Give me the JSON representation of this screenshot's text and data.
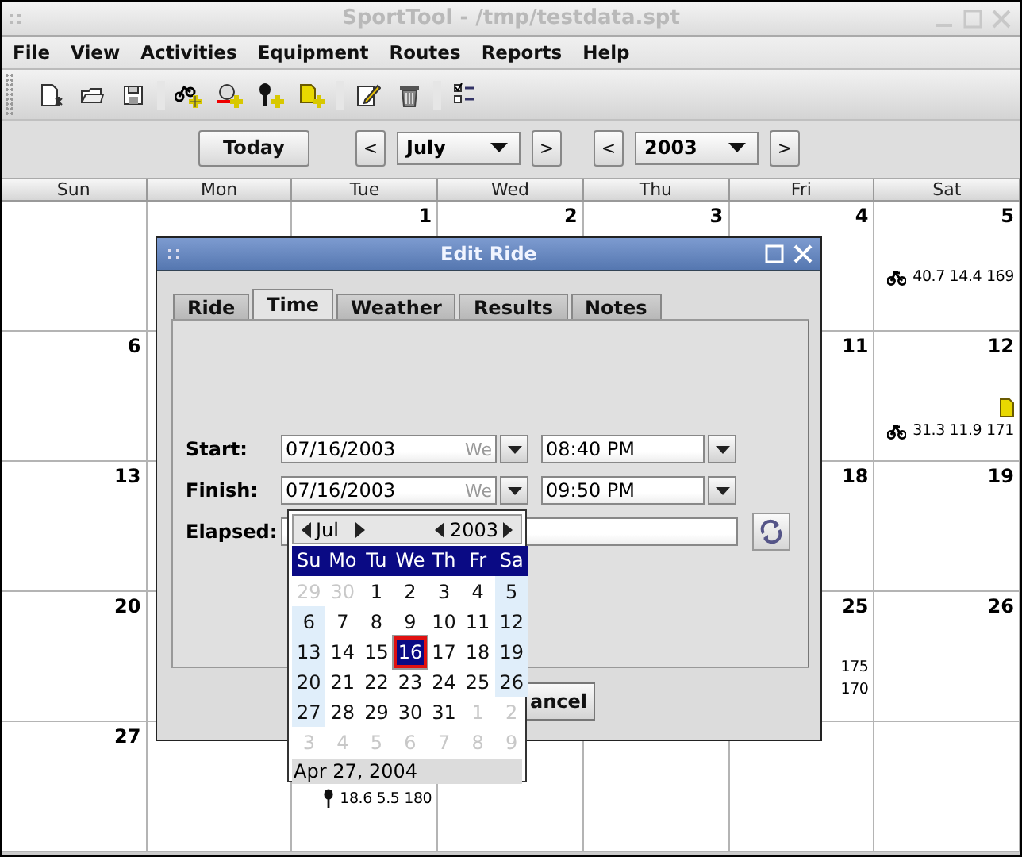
{
  "window": {
    "title": "SportTool - /tmp/testdata.spt"
  },
  "menu": [
    "File",
    "View",
    "Activities",
    "Equipment",
    "Routes",
    "Reports",
    "Help"
  ],
  "navigator": {
    "today": "Today",
    "month_prev": "<",
    "month": "July",
    "month_next": ">",
    "year_prev": "<",
    "year": "2003",
    "year_next": ">"
  },
  "calendar": {
    "weekdays": [
      "Sun",
      "Mon",
      "Tue",
      "Wed",
      "Thu",
      "Fri",
      "Sat"
    ],
    "weeks": [
      {
        "tue": {
          "day": "1"
        },
        "wed": {
          "day": "2"
        },
        "thu": {
          "day": "3"
        },
        "fri": {
          "day": "4"
        },
        "sat": {
          "day": "5",
          "entries": [
            {
              "kind": "ride",
              "text": "40.7 14.4 169"
            }
          ]
        }
      },
      {
        "sun": {
          "day": "6"
        },
        "fri": {
          "day": "11"
        },
        "sat": {
          "day": "12",
          "entries": [
            {
              "kind": "note"
            },
            {
              "kind": "ride",
              "text": "31.3 11.9 171"
            }
          ]
        }
      },
      {
        "sun": {
          "day": "13"
        },
        "fri": {
          "day": "18"
        },
        "sat": {
          "day": "19"
        }
      },
      {
        "sun": {
          "day": "20"
        },
        "fri": {
          "day": "25",
          "entries": [
            {
              "text": "175"
            },
            {
              "text": "170"
            }
          ]
        },
        "sat": {
          "day": "26"
        }
      },
      {
        "sun": {
          "day": "27"
        },
        "tue": {
          "entries": [
            {
              "kind": "pin",
              "text": "18.6 5.5 180"
            }
          ]
        }
      }
    ]
  },
  "dialog": {
    "title": "Edit Ride",
    "tabs": [
      {
        "label": "Ride",
        "selected": false
      },
      {
        "label": "Time",
        "selected": true
      },
      {
        "label": "Weather",
        "selected": false
      },
      {
        "label": "Results",
        "selected": false
      },
      {
        "label": "Notes",
        "selected": false
      }
    ],
    "start": {
      "label": "Start:",
      "date": "07/16/2003",
      "weekday": "We",
      "time": "08:40 PM"
    },
    "finish": {
      "label": "Finish:",
      "date": "07/16/2003",
      "weekday": "We",
      "time": "09:50 PM"
    },
    "elapsed": {
      "label": "Elapsed:"
    },
    "cancel_button": "ancel"
  },
  "date_picker": {
    "month": "Jul",
    "year": "2003",
    "weekdays": [
      "Su",
      "Mo",
      "Tu",
      "We",
      "Th",
      "Fr",
      "Sa"
    ],
    "weeks": [
      [
        {
          "day": "29",
          "outside": true,
          "selected": false
        },
        {
          "day": "30",
          "outside": true,
          "selected": false
        },
        {
          "day": "1",
          "outside": false,
          "selected": false
        },
        {
          "day": "2",
          "outside": false,
          "selected": false
        },
        {
          "day": "3",
          "outside": false,
          "selected": false
        },
        {
          "day": "4",
          "outside": false,
          "selected": false
        },
        {
          "day": "5",
          "outside": false,
          "selected": false
        }
      ],
      [
        {
          "day": "6",
          "outside": false,
          "selected": false
        },
        {
          "day": "7",
          "outside": false,
          "selected": false
        },
        {
          "day": "8",
          "outside": false,
          "selected": false
        },
        {
          "day": "9",
          "outside": false,
          "selected": false
        },
        {
          "day": "10",
          "outside": false,
          "selected": false
        },
        {
          "day": "11",
          "outside": false,
          "selected": false
        },
        {
          "day": "12",
          "outside": false,
          "selected": false
        }
      ],
      [
        {
          "day": "13",
          "outside": false,
          "selected": false
        },
        {
          "day": "14",
          "outside": false,
          "selected": false
        },
        {
          "day": "15",
          "outside": false,
          "selected": false
        },
        {
          "day": "16",
          "outside": false,
          "selected": true
        },
        {
          "day": "17",
          "outside": false,
          "selected": false
        },
        {
          "day": "18",
          "outside": false,
          "selected": false
        },
        {
          "day": "19",
          "outside": false,
          "selected": false
        }
      ],
      [
        {
          "day": "20",
          "outside": false,
          "selected": false
        },
        {
          "day": "21",
          "outside": false,
          "selected": false
        },
        {
          "day": "22",
          "outside": false,
          "selected": false
        },
        {
          "day": "23",
          "outside": false,
          "selected": false
        },
        {
          "day": "24",
          "outside": false,
          "selected": false
        },
        {
          "day": "25",
          "outside": false,
          "selected": false
        },
        {
          "day": "26",
          "outside": false,
          "selected": false
        }
      ],
      [
        {
          "day": "27",
          "outside": false,
          "selected": false
        },
        {
          "day": "28",
          "outside": false,
          "selected": false
        },
        {
          "day": "29",
          "outside": false,
          "selected": false
        },
        {
          "day": "30",
          "outside": false,
          "selected": false
        },
        {
          "day": "31",
          "outside": false,
          "selected": false
        },
        {
          "day": "1",
          "outside": true,
          "selected": false
        },
        {
          "day": "2",
          "outside": true,
          "selected": false
        }
      ],
      [
        {
          "day": "3",
          "outside": true,
          "selected": false
        },
        {
          "day": "4",
          "outside": true,
          "selected": false
        },
        {
          "day": "5",
          "outside": true,
          "selected": false
        },
        {
          "day": "6",
          "outside": true,
          "selected": false
        },
        {
          "day": "7",
          "outside": true,
          "selected": false
        },
        {
          "day": "8",
          "outside": true,
          "selected": false
        },
        {
          "day": "9",
          "outside": true,
          "selected": false
        }
      ]
    ],
    "today_label": "Apr 27, 2004"
  }
}
